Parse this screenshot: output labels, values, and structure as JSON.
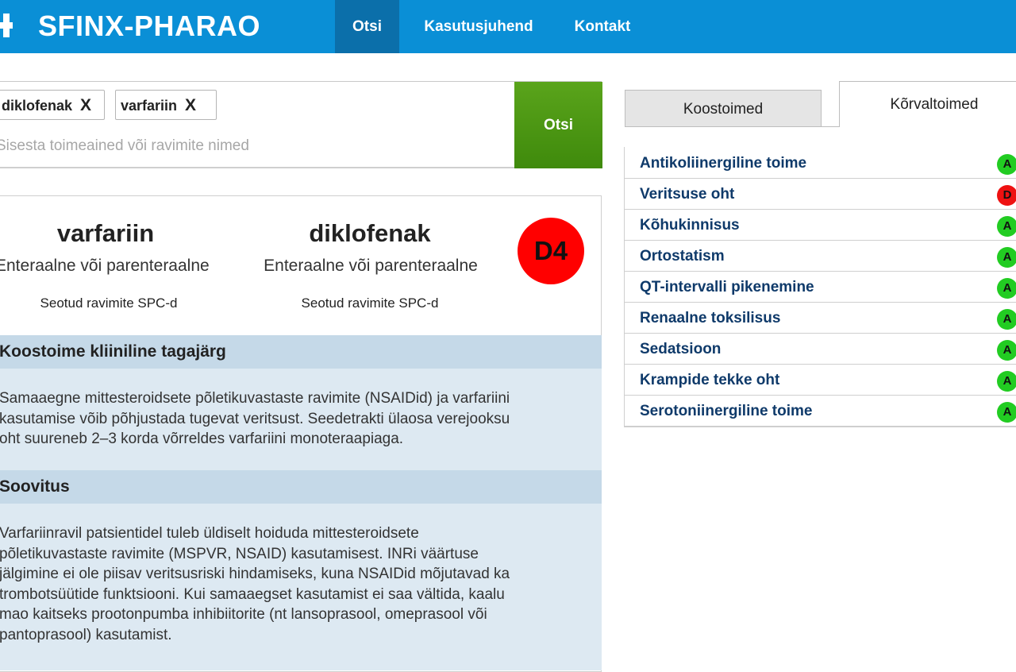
{
  "header": {
    "brand": "SFINX-PHARAO",
    "nav": [
      {
        "label": "Otsi",
        "active": true
      },
      {
        "label": "Kasutusjuhend",
        "active": false
      },
      {
        "label": "Kontakt",
        "active": false
      }
    ],
    "bar_color": "#0a8fd6",
    "active_color": "#0b6faa"
  },
  "search": {
    "chips": [
      {
        "label": "diklofenak",
        "remove": "X"
      },
      {
        "label": "varfariin",
        "remove": "X"
      }
    ],
    "placeholder": "Sisesta toimeained või ravimite nimed",
    "button_label": "Otsi",
    "button_color": "#4c9a14"
  },
  "interaction": {
    "drugs": [
      {
        "name": "varfariin",
        "route": "Enteraalne või parenteraalne",
        "spc_link": "Seotud ravimite SPC-d"
      },
      {
        "name": "diklofenak",
        "route": "Enteraalne või parenteraalne",
        "spc_link": "Seotud ravimite SPC-d"
      }
    ],
    "class_badge": "D4",
    "badge_color": "#ff0000",
    "sections": [
      {
        "title": "Koostoime kliiniline tagajärg",
        "lines": [
          "Samaaegne mittesteroidsete põletikuvastaste ravimite (NSAIDid) ja varfariini",
          "kasutamise võib põhjustada tugevat veritsust. Seedetrakti ülaosa verejooksu",
          "oht suureneb 2–3 korda võrreldes varfariini monoteraapiaga."
        ]
      },
      {
        "title": "Soovitus",
        "lines": [
          "Varfariinravil patsientidel tuleb üldiselt hoiduda mittesteroidsete",
          "põletikuvastaste ravimite (MSPVR, NSAID) kasutamisest. INRi väärtuse",
          "jälgimine ei ole piisav veritsusriski hindamiseks, kuna NSAIDid mõjutavad ka",
          "trombotsüütide funktsiooni. Kui samaaegset kasutamist ei saa vältida, kaalu",
          "mao kaitseks prootonpumba inhibiitorite (nt lansoprasool, omeprasool või",
          "pantoprasool) kasutamist."
        ]
      }
    ]
  },
  "tabs": [
    {
      "label": "Koostoimed",
      "active": false
    },
    {
      "label": "Kõrvaltoimed",
      "active": true
    }
  ],
  "side_effects": [
    {
      "label": "Antikoliinergiline toime",
      "grade": "A",
      "color": "#22cc22"
    },
    {
      "label": "Veritsuse oht",
      "grade": "D",
      "color": "#ee1111"
    },
    {
      "label": "Kõhukinnisus",
      "grade": "A",
      "color": "#22cc22"
    },
    {
      "label": "Ortostatism",
      "grade": "A",
      "color": "#22cc22"
    },
    {
      "label": "QT-intervalli pikenemine",
      "grade": "A",
      "color": "#22cc22"
    },
    {
      "label": "Renaalne toksilisus",
      "grade": "A",
      "color": "#22cc22"
    },
    {
      "label": "Sedatsioon",
      "grade": "A",
      "color": "#22cc22"
    },
    {
      "label": "Krampide tekke oht",
      "grade": "A",
      "color": "#22cc22"
    },
    {
      "label": "Serotoniinergiline toime",
      "grade": "A",
      "color": "#22cc22"
    }
  ]
}
